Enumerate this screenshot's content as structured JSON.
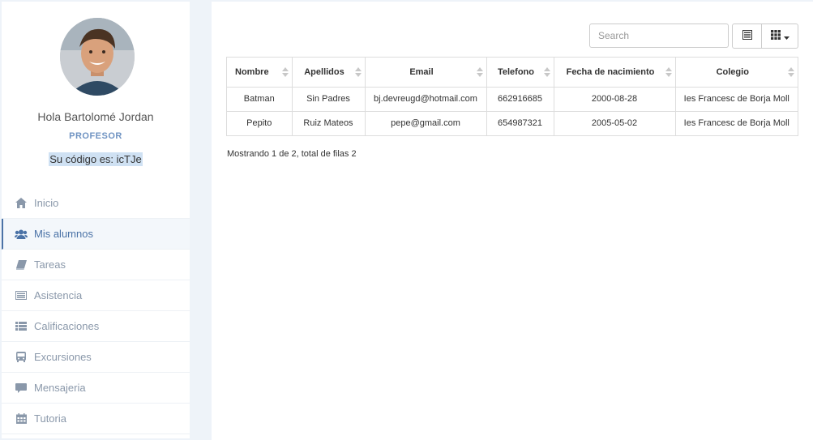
{
  "profile": {
    "greeting": "Hola Bartolomé Jordan",
    "role": "PROFESOR",
    "code": "Su código es: icTJe"
  },
  "nav": [
    {
      "label": "Inicio",
      "icon": "home-icon"
    },
    {
      "label": "Mis alumnos",
      "icon": "users-icon",
      "active": true
    },
    {
      "label": "Tareas",
      "icon": "book-icon"
    },
    {
      "label": "Asistencia",
      "icon": "list-alt-icon"
    },
    {
      "label": "Calificaciones",
      "icon": "list-icon"
    },
    {
      "label": "Excursiones",
      "icon": "bus-icon"
    },
    {
      "label": "Mensajeria",
      "icon": "comment-icon"
    },
    {
      "label": "Tutoria",
      "icon": "calendar-icon"
    }
  ],
  "toolbar": {
    "search_placeholder": "Search"
  },
  "table": {
    "headers": [
      "Nombre",
      "Apellidos",
      "Email",
      "Telefono",
      "Fecha de nacimiento",
      "Colegio"
    ],
    "rows": [
      [
        "Batman",
        "Sin Padres",
        "bj.devreugd@hotmail.com",
        "662916685",
        "2000-08-28",
        "Ies Francesc de Borja Moll"
      ],
      [
        "Pepito",
        "Ruiz Mateos",
        "pepe@gmail.com",
        "654987321",
        "2005-05-02",
        "Ies Francesc de Borja Moll"
      ]
    ]
  },
  "footer": {
    "summary": "Mostrando 1 de 2, total de filas 2"
  },
  "colors": {
    "accent": "#4a72a6",
    "role": "#6f93c2",
    "code_highlight": "#cfe1f3",
    "nav_text": "#8a98aa"
  }
}
